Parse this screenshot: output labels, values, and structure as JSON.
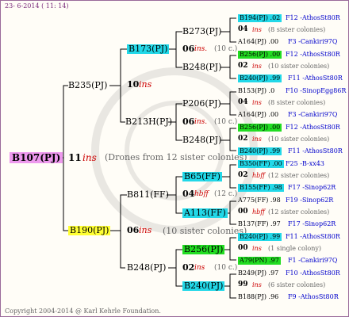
{
  "header": {
    "date": "23- 6-2014 ( 11: 14)"
  },
  "footer": {
    "copyright": "Copyright 2004-2014 @ Karl Kehrle Foundation."
  },
  "root": {
    "name": "B107(PJ)",
    "num": "11",
    "ins": "ins",
    "note": "(Drones from 12 sister colonies)"
  },
  "g1": [
    {
      "name": "B235(PJ)",
      "num": "10",
      "ins": "ins"
    },
    {
      "name": "B190(PJ)",
      "num": "06",
      "ins": "ins",
      "note": "(10 sister colonies)"
    }
  ],
  "g2": [
    {
      "name": "B173(PJ)",
      "num": "06",
      "ins": "ins.",
      "note": "(10 c.)"
    },
    {
      "name": "B213H(PJ)",
      "num": "06",
      "ins": "ins.",
      "note": "(10 c.)"
    },
    {
      "name": "B811(FF)",
      "num": "04",
      "ins": "hbff",
      "note": "(12 c.)"
    },
    {
      "name": "B248(PJ)",
      "num": "02",
      "ins": "ins",
      "note": "(10 c.)"
    }
  ],
  "g3": [
    {
      "name": "B273(PJ)"
    },
    {
      "name": "B248(PJ)"
    },
    {
      "name": "P206(PJ)"
    },
    {
      "name": "B248(PJ)"
    },
    {
      "name": "B65(FF)"
    },
    {
      "name": "A113(FF)"
    },
    {
      "name": "B256(PJ)"
    },
    {
      "name": "B240(PJ)"
    }
  ],
  "g4": [
    {
      "l1": "B194(PJ) .02",
      "l1b": "F12 -AthosSt80R",
      "mid_num": "04",
      "mid_ins": "ins",
      "mid_note": "(8 sister colonies)",
      "l2": "A164(PJ) .00",
      "l2b": "F3 -Cankiri97Q"
    },
    {
      "l1": "B256(PJ) .00",
      "l1b": "F12 -AthosSt80R",
      "mid_num": "02",
      "mid_ins": "ins",
      "mid_note": "(10 sister colonies)",
      "l2": "B240(PJ) .99",
      "l2b": "F11 -AthosSt80R"
    },
    {
      "l1": "B153(PJ) .0",
      "l1b": "F10 -SinopEgg86R",
      "mid_num": "04",
      "mid_ins": "ins",
      "mid_note": "(8 sister colonies)",
      "l2": "A164(PJ) .00",
      "l2b": "F3 -Cankiri97Q"
    },
    {
      "l1": "B256(PJ) .00",
      "l1b": "F12 -AthosSt80R",
      "mid_num": "02",
      "mid_ins": "ins",
      "mid_note": "(10 sister colonies)",
      "l2": "B240(PJ) .99",
      "l2b": "F11 -AthosSt80R"
    },
    {
      "l1": "B350(FF) .00",
      "l1b": "F25 -B-xx43",
      "mid_num": "02",
      "mid_ins": "hbff",
      "mid_note": "(12 sister colonies)",
      "l2": "B155(FF) .98",
      "l2b": "F17 -Sinop62R"
    },
    {
      "l1": "A775(FF) .98",
      "l1b": "F19 -Sinop62R",
      "mid_num": "00",
      "mid_ins": "hbff",
      "mid_note": "(12 sister colonies)",
      "l2": "B137(FF) .97",
      "l2b": "F17 -Sinop62R"
    },
    {
      "l1": "B240(PJ) .99",
      "l1b": "F11 -AthosSt80R",
      "mid_num": "00",
      "mid_ins": "ins",
      "mid_note": "(1 single colony)",
      "l2": "A79(PN) .97",
      "l2b": "F1 -Cankiri97Q"
    },
    {
      "l1": "B249(PJ) .97",
      "l1b": "F10 -AthosSt80R",
      "mid_num": "99",
      "mid_ins": "ins",
      "mid_note": "(6 sister colonies)",
      "l2": "B188(PJ) .96",
      "l2b": "F9 -AthosSt80R"
    }
  ]
}
